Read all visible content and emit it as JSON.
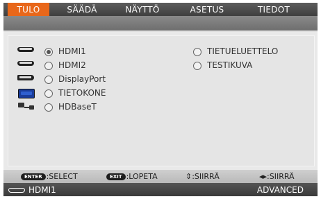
{
  "tabs": [
    {
      "label": "TULO",
      "active": true
    },
    {
      "label": "SÄÄDÄ",
      "active": false
    },
    {
      "label": "NÄYTTÖ",
      "active": false
    },
    {
      "label": "ASETUS",
      "active": false
    },
    {
      "label": "TIEDOT",
      "active": false
    }
  ],
  "inputs": {
    "left": [
      {
        "label": "HDMI1",
        "icon": "hdmi-icon",
        "selected": true
      },
      {
        "label": "HDMI2",
        "icon": "hdmi-icon",
        "selected": false
      },
      {
        "label": "DisplayPort",
        "icon": "displayport-icon",
        "selected": false
      },
      {
        "label": "TIETOKONE",
        "icon": "computer-vga-icon",
        "selected": false
      },
      {
        "label": "HDBaseT",
        "icon": "hdbaset-icon",
        "selected": false
      }
    ],
    "right": [
      {
        "label": "TIETUELUETTELO",
        "selected": false
      },
      {
        "label": "TESTIKUVA",
        "selected": false
      }
    ]
  },
  "footer": {
    "enter_key": "ENTER",
    "select_label": ":SELECT",
    "exit_key": "EXIT",
    "exit_label": ":LOPETA",
    "move_updown": "⇕:SIIRRÄ",
    "move_leftright": "◂▸:SIIRRÄ"
  },
  "status": {
    "source": "HDMI1",
    "mode": "ADVANCED"
  },
  "colors": {
    "active_tab": "#e8671a",
    "tab_bar": "#4a4a4a",
    "panel": "#e5e5e5"
  }
}
